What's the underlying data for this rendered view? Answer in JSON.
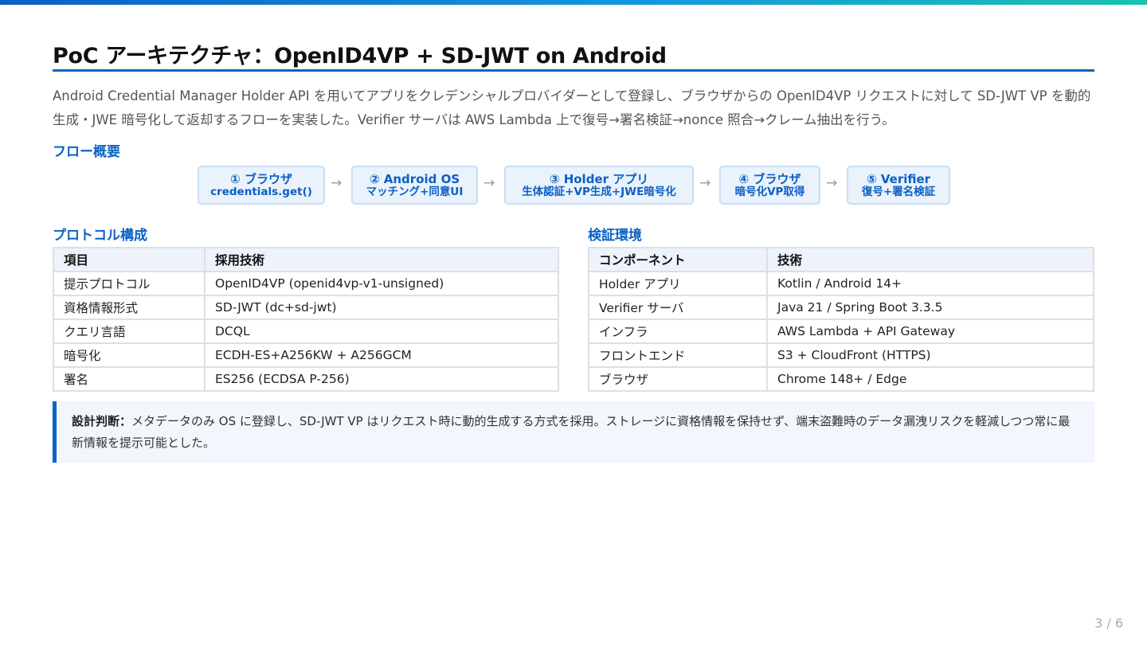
{
  "title": "PoC アーキテクチャ：OpenID4VP + SD-JWT on Android",
  "intro": "Android Credential Manager Holder API を用いてアプリをクレデンシャルプロバイダーとして登録し、ブラウザからの OpenID4VP リクエストに対して SD-JWT VP を動的生成・JWE 暗号化して返却するフローを実装した。Verifier サーバは AWS Lambda 上で復号→署名検証→nonce 照合→クレーム抽出を行う。",
  "flow": {
    "heading": "フロー概要",
    "steps": [
      {
        "line1": "① ブラウザ",
        "line2": "credentials.get()"
      },
      {
        "line1": "② Android OS",
        "line2": "マッチング+同意UI"
      },
      {
        "line1": "③ Holder アプリ",
        "line2": "生体認証+VP生成+JWE暗号化"
      },
      {
        "line1": "④ ブラウザ",
        "line2": "暗号化VP取得"
      },
      {
        "line1": "⑤ Verifier",
        "line2": "復号+署名検証"
      }
    ],
    "arrow": "→"
  },
  "protocol": {
    "heading": "プロトコル構成",
    "headers": [
      "項目",
      "採用技術"
    ],
    "rows": [
      [
        "提示プロトコル",
        "OpenID4VP (openid4vp-v1-unsigned)"
      ],
      [
        "資格情報形式",
        "SD-JWT (dc+sd-jwt)"
      ],
      [
        "クエリ言語",
        "DCQL"
      ],
      [
        "暗号化",
        "ECDH-ES+A256KW + A256GCM"
      ],
      [
        "署名",
        "ES256 (ECDSA P-256)"
      ]
    ]
  },
  "env": {
    "heading": "検証環境",
    "headers": [
      "コンポーネント",
      "技術"
    ],
    "rows": [
      [
        "Holder アプリ",
        "Kotlin / Android 14+"
      ],
      [
        "Verifier サーバ",
        "Java 21 / Spring Boot 3.3.5"
      ],
      [
        "インフラ",
        "AWS Lambda + API Gateway"
      ],
      [
        "フロントエンド",
        "S3 + CloudFront (HTTPS)"
      ],
      [
        "ブラウザ",
        "Chrome 148+ / Edge"
      ]
    ]
  },
  "note": {
    "label": "設計判断：",
    "text": "メタデータのみ OS に登録し、SD-JWT VP はリクエスト時に動的生成する方式を採用。ストレージに資格情報を保持せず、端末盗難時のデータ漏洩リスクを軽減しつつ常に最新情報を提示可能とした。"
  },
  "page_number": "3 / 6",
  "colors": {
    "accent": "#0b63c5",
    "step_bg": "#eaf2fc",
    "header_bg": "#eef3fb"
  }
}
